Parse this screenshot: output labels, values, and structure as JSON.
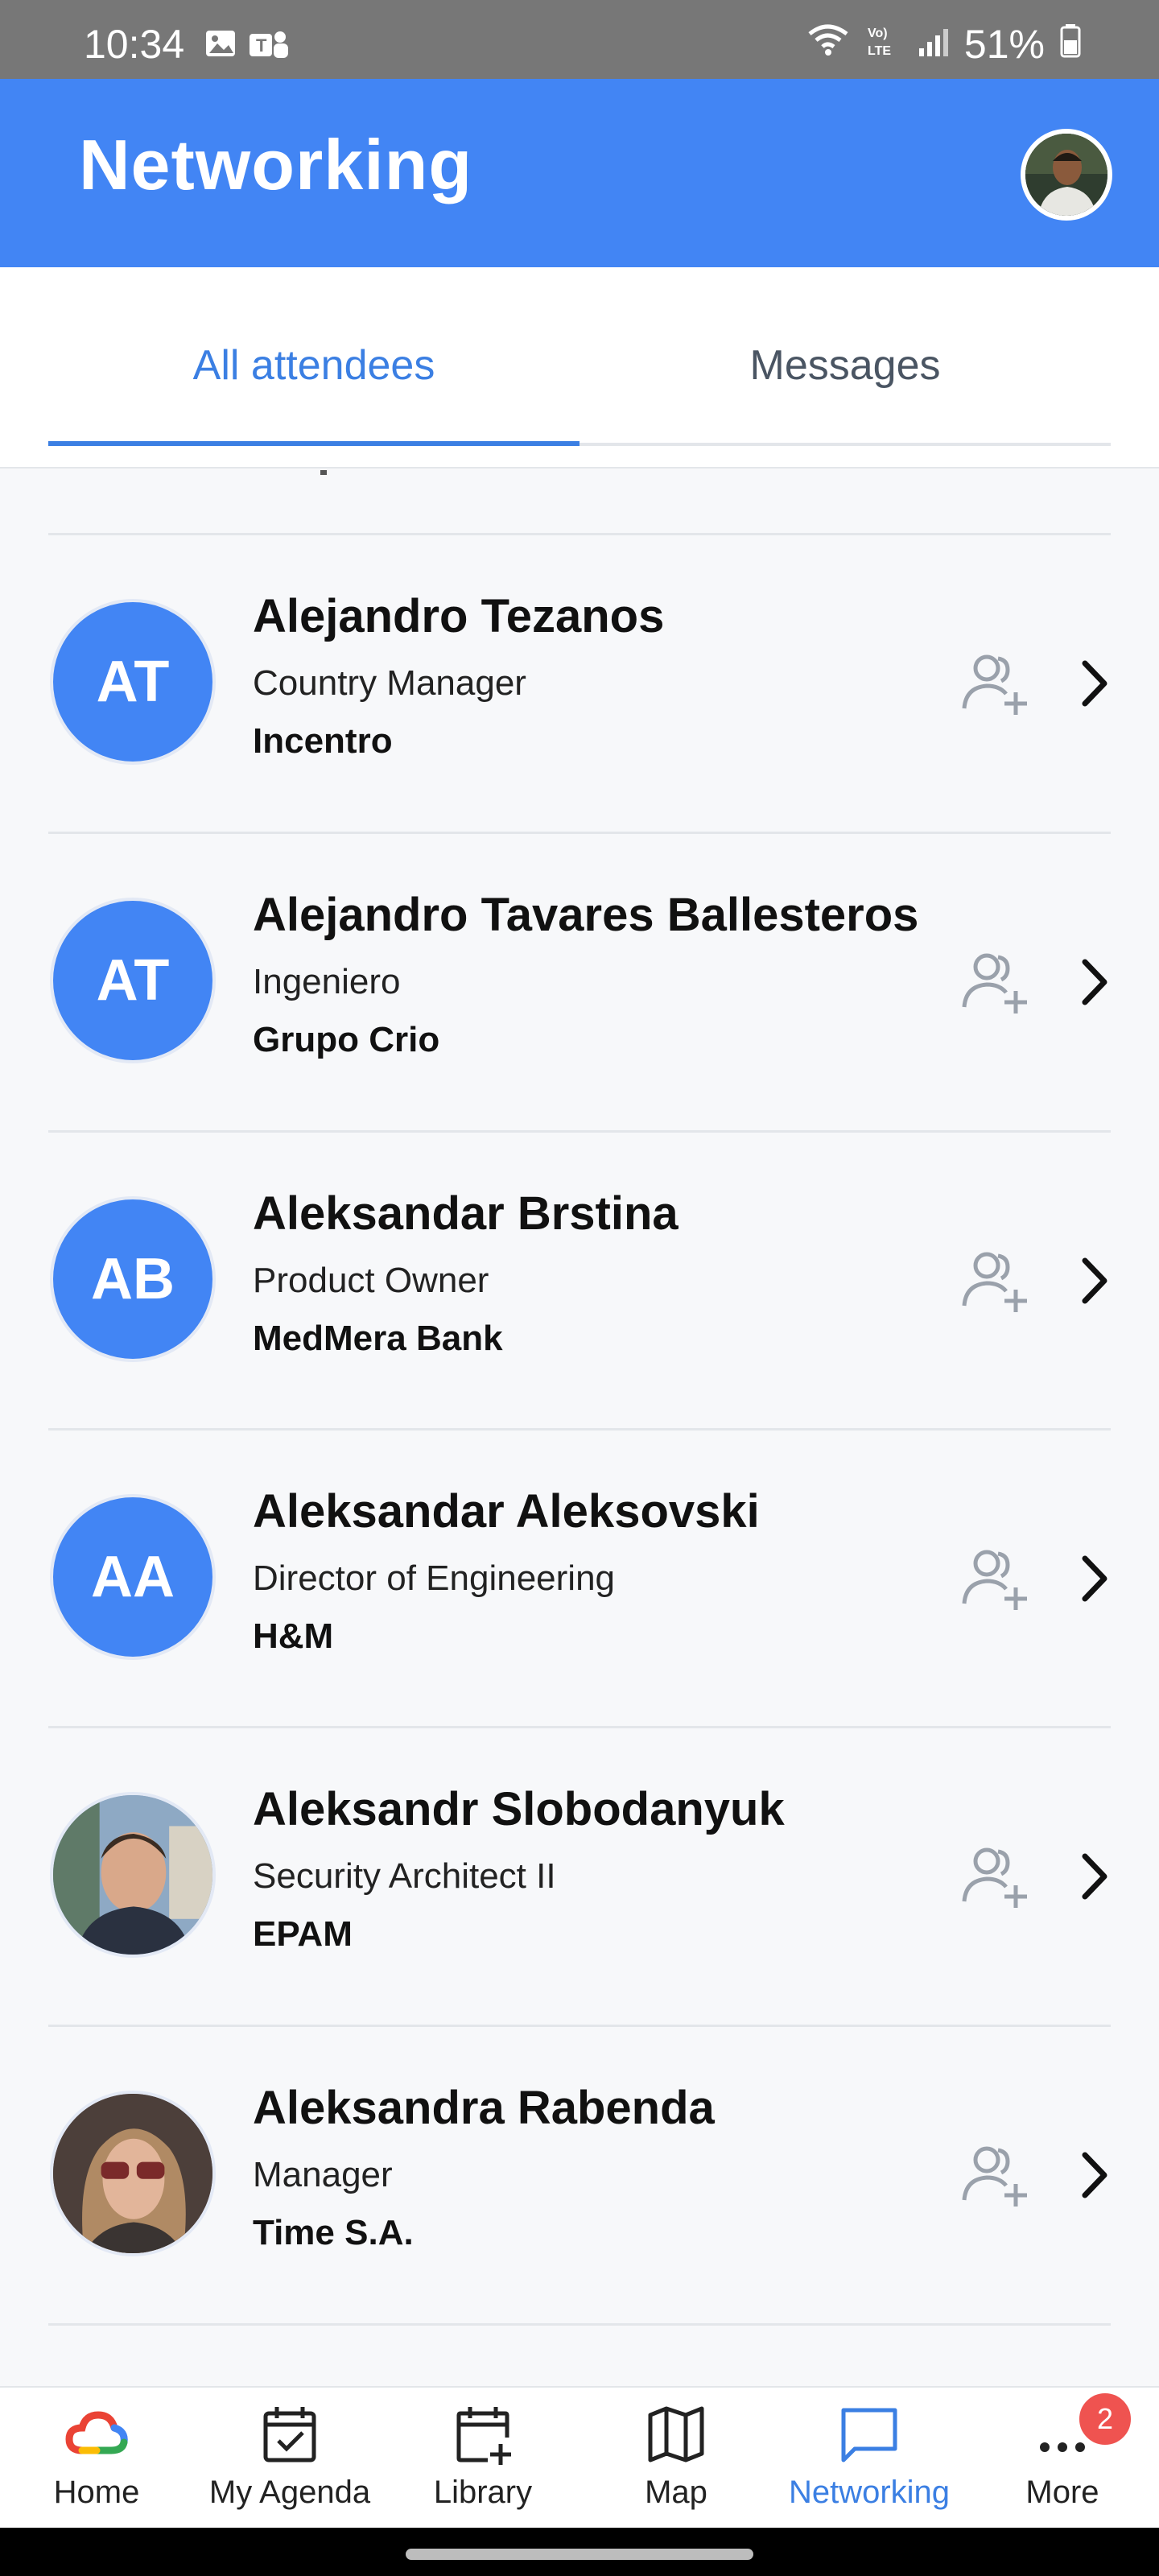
{
  "status_bar": {
    "time": "10:34",
    "battery": "51%",
    "network": "LTE"
  },
  "header": {
    "title": "Networking"
  },
  "tabs": [
    {
      "label": "All attendees",
      "active": true
    },
    {
      "label": "Messages",
      "active": false
    }
  ],
  "attendees": [
    {
      "initials": "AT",
      "name": "Alejandro Tezanos",
      "title": "Country Manager",
      "company": "Incentro",
      "has_photo": false
    },
    {
      "initials": "AT",
      "name": "Alejandro Tavares Ballesteros",
      "title": "Ingeniero",
      "company": "Grupo Crio",
      "has_photo": false
    },
    {
      "initials": "AB",
      "name": "Aleksandar Brstina",
      "title": "Product Owner",
      "company": "MedMera Bank",
      "has_photo": false
    },
    {
      "initials": "AA",
      "name": "Aleksandar Aleksovski",
      "title": "Director of Engineering",
      "company": "H&M",
      "has_photo": false
    },
    {
      "initials": "",
      "name": "Aleksandr Slobodanyuk",
      "title": "Security Architect II",
      "company": "EPAM",
      "has_photo": true
    },
    {
      "initials": "",
      "name": "Aleksandra Rabenda",
      "title": "Manager",
      "company": "Time S.A.",
      "has_photo": true
    }
  ],
  "bottom_nav": [
    {
      "label": "Home",
      "icon": "google-cloud-icon",
      "active": false
    },
    {
      "label": "My Agenda",
      "icon": "calendar-check-icon",
      "active": false
    },
    {
      "label": "Library",
      "icon": "calendar-plus-icon",
      "active": false
    },
    {
      "label": "Map",
      "icon": "map-icon",
      "active": false
    },
    {
      "label": "Networking",
      "icon": "chat-icon",
      "active": true
    },
    {
      "label": "More",
      "icon": "more-dots-icon",
      "active": false,
      "badge": "2"
    }
  ],
  "colors": {
    "primary": "#4285f4",
    "active_tab": "#3b7fe3",
    "badge": "#ef5350",
    "background": "#f7f8fa"
  }
}
